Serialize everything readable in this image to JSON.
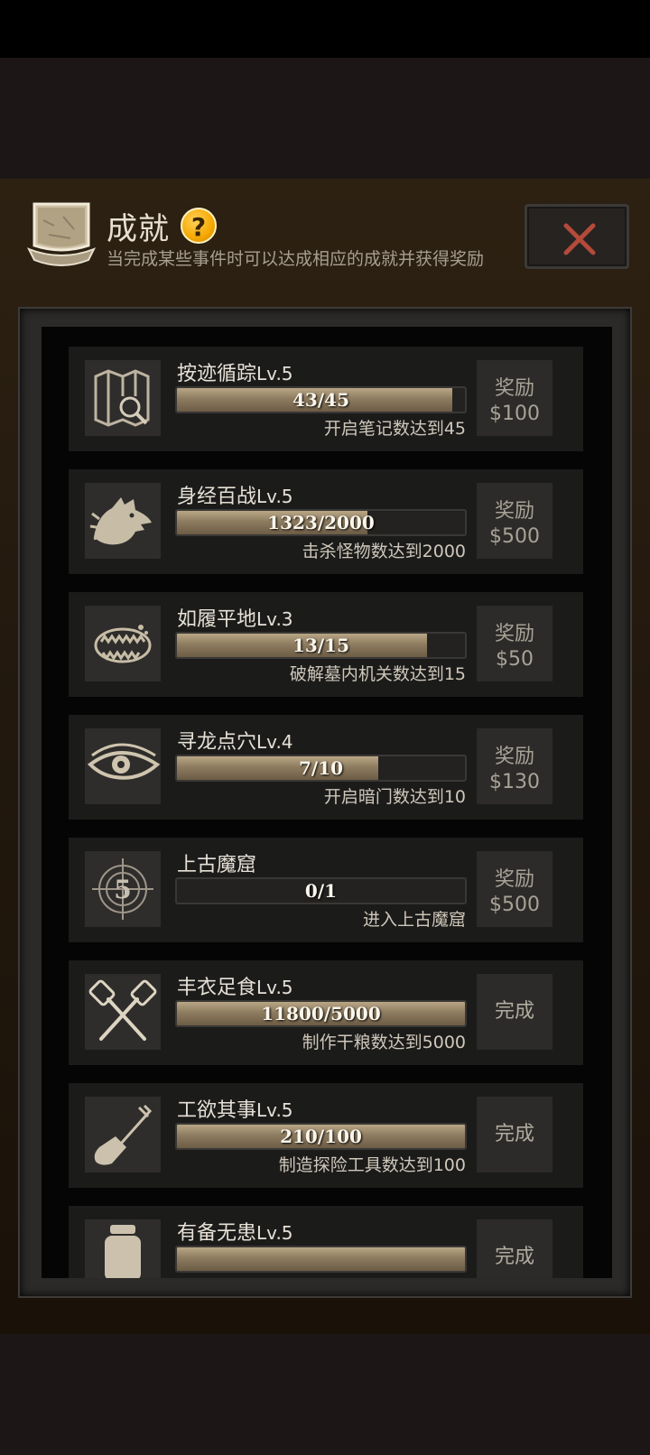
{
  "header": {
    "title": "成就",
    "help": "?",
    "subtitle": "当完成某些事件时可以达成相应的成就并获得奖励"
  },
  "colors": {
    "panel_bg": "#2d2112",
    "row_bg": "#1b1b1a",
    "bar_fill": "#b8a685",
    "close_x": "#b44a3a",
    "help_gold": "#f5a800"
  },
  "achievements": [
    {
      "name": "按迹循踪",
      "level": "Lv.5",
      "progress": "43/45",
      "fraction": 0.956,
      "desc": "开启笔记数达到45",
      "reward_label": "奖励",
      "reward": "$100",
      "icon": "map-search-icon"
    },
    {
      "name": "身经百战",
      "level": "Lv.5",
      "progress": "1323/2000",
      "fraction": 0.6615,
      "desc": "击杀怪物数达到2000",
      "reward_label": "奖励",
      "reward": "$500",
      "icon": "wolf-head-icon"
    },
    {
      "name": "如履平地",
      "level": "Lv.3",
      "progress": "13/15",
      "fraction": 0.867,
      "desc": "破解墓内机关数达到15",
      "reward_label": "奖励",
      "reward": "$50",
      "icon": "bear-trap-icon"
    },
    {
      "name": "寻龙点穴",
      "level": "Lv.4",
      "progress": "7/10",
      "fraction": 0.7,
      "desc": "开启暗门数达到10",
      "reward_label": "奖励",
      "reward": "$130",
      "icon": "eye-icon"
    },
    {
      "name": "上古魔窟",
      "level": "",
      "progress": "0/1",
      "fraction": 0.0,
      "desc": "进入上古魔窟",
      "reward_label": "奖励",
      "reward": "$500",
      "icon": "countdown-five-icon"
    },
    {
      "name": "丰衣足食",
      "level": "Lv.5",
      "progress": "11800/5000",
      "fraction": 1.0,
      "desc": "制作干粮数达到5000",
      "done": "完成",
      "icon": "crossed-spatulas-icon"
    },
    {
      "name": "工欲其事",
      "level": "Lv.5",
      "progress": "210/100",
      "fraction": 1.0,
      "desc": "制造探险工具数达到100",
      "done": "完成",
      "icon": "shovel-icon"
    },
    {
      "name": "有备无患",
      "level": "Lv.5",
      "progress": "",
      "fraction": 1.0,
      "desc": "",
      "done": "完成",
      "icon": "jar-icon"
    }
  ]
}
